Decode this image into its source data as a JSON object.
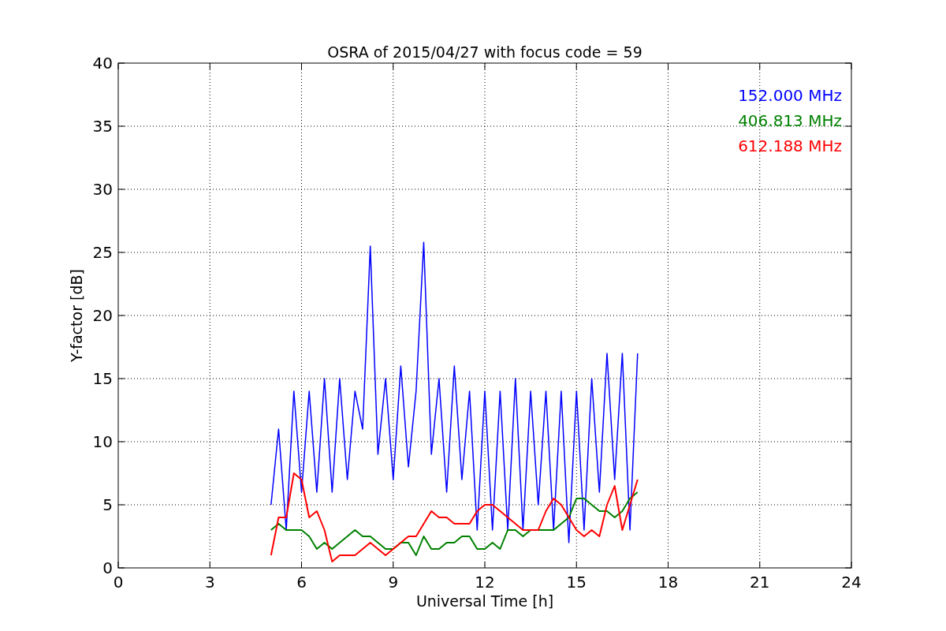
{
  "figure": {
    "chart_data": {
      "type": "line",
      "grid": true,
      "title": "OSRA of 2015/04/27 with focus code = 59",
      "xlabel": "Universal Time [h]",
      "ylabel": "Y-factor [dB]",
      "xlim": [
        0,
        24
      ],
      "ylim": [
        0,
        40
      ],
      "xticks": [
        0,
        3,
        6,
        9,
        12,
        15,
        18,
        21,
        24
      ],
      "yticks": [
        0,
        5,
        10,
        15,
        20,
        25,
        30,
        35,
        40
      ],
      "x": [
        5,
        5.25,
        5.5,
        5.75,
        6,
        6.25,
        6.5,
        6.75,
        7,
        7.25,
        7.5,
        7.75,
        8,
        8.25,
        8.5,
        8.75,
        9,
        9.25,
        9.5,
        9.75,
        10,
        10.25,
        10.5,
        10.75,
        11,
        11.25,
        11.5,
        11.75,
        12,
        12.25,
        12.5,
        12.75,
        13,
        13.25,
        13.5,
        13.75,
        14,
        14.25,
        14.5,
        14.75,
        15,
        15.25,
        15.5,
        15.75,
        16,
        16.25,
        16.5,
        16.75,
        17
      ],
      "series": [
        {
          "name": "152.000 MHz",
          "color": "#0000ff",
          "values": [
            5,
            11,
            3,
            14,
            6,
            14,
            6,
            15,
            6,
            15,
            7,
            14,
            11,
            25.5,
            9,
            15,
            7,
            16,
            8,
            14,
            25.8,
            9,
            15,
            6,
            16,
            7,
            14,
            3,
            14,
            3,
            14,
            3,
            15,
            3,
            14,
            5,
            14,
            3,
            14,
            2,
            14,
            3,
            15,
            6,
            17,
            7,
            17,
            3,
            17
          ]
        },
        {
          "name": "406.813 MHz",
          "color": "#008000",
          "values": [
            3,
            3.5,
            3,
            3,
            3,
            2.5,
            1.5,
            2,
            1.5,
            2,
            2.5,
            3,
            2.5,
            2.5,
            2,
            1.5,
            1.5,
            2,
            2,
            1,
            2.5,
            1.5,
            1.5,
            2,
            2,
            2.5,
            2.5,
            1.5,
            1.5,
            2,
            1.5,
            3,
            3,
            2.5,
            3,
            3,
            3,
            3,
            3.5,
            4,
            5.5,
            5.5,
            5,
            4.5,
            4.5,
            4,
            4.5,
            5.5,
            6
          ]
        },
        {
          "name": "612.188 MHz",
          "color": "#ff0000",
          "values": [
            1,
            4,
            4,
            7.5,
            7,
            4,
            4.5,
            3,
            0.5,
            1,
            1,
            1,
            1.5,
            2,
            1.5,
            1,
            1.5,
            2,
            2.5,
            2.5,
            3.5,
            4.5,
            4,
            4,
            3.5,
            3.5,
            3.5,
            4.5,
            5,
            5,
            4.5,
            4,
            3.5,
            3,
            3,
            3,
            4.5,
            5.5,
            5,
            4,
            3,
            2.5,
            3,
            2.5,
            5,
            6.5,
            3,
            5,
            7
          ]
        }
      ]
    }
  }
}
